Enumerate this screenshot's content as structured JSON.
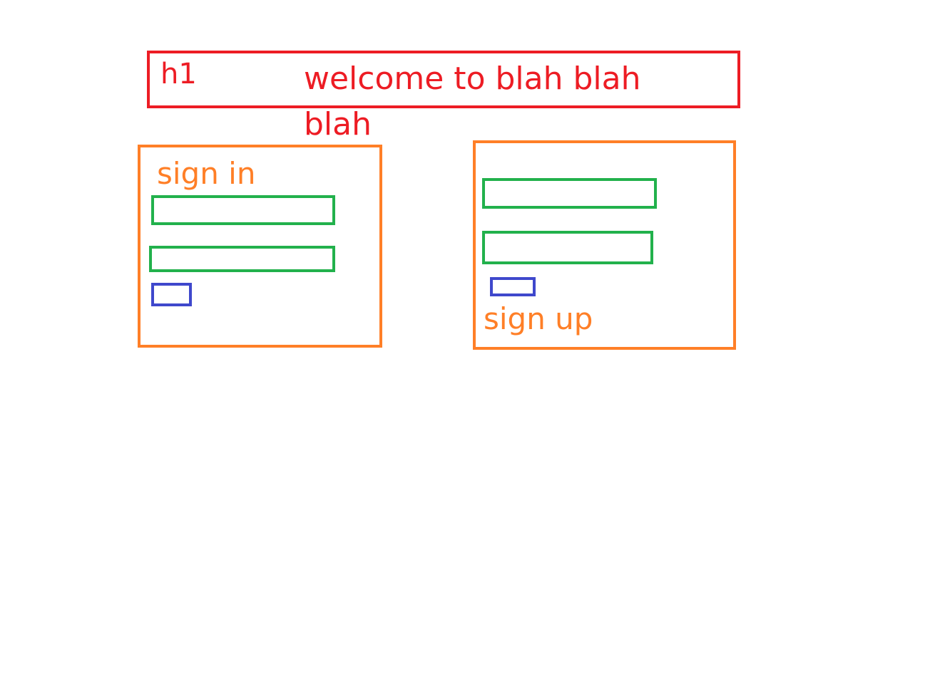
{
  "header": {
    "tag": "h1",
    "title_line1": "welcome to blah blah",
    "title_line2": "blah"
  },
  "signin": {
    "label": "sign in"
  },
  "signup": {
    "label": "sign up"
  },
  "colors": {
    "header": "#ed1c24",
    "panel": "#ff7f27",
    "field": "#22b14c",
    "button": "#3f48cc"
  }
}
